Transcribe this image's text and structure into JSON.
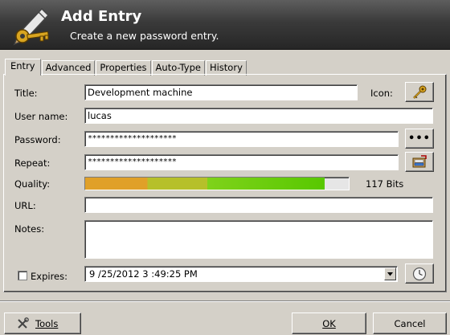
{
  "header": {
    "title": "Add Entry",
    "subtitle": "Create a new password entry."
  },
  "tabs": [
    "Entry",
    "Advanced",
    "Properties",
    "Auto-Type",
    "History"
  ],
  "form": {
    "title_label": "Title:",
    "title_value": "Development machine",
    "icon_label": "Icon:",
    "username_label": "User name:",
    "username_value": "lucas",
    "password_label": "Password:",
    "password_value": "********************",
    "repeat_label": "Repeat:",
    "repeat_value": "********************",
    "quality_label": "Quality:",
    "quality_fraction": 0.91,
    "quality_bits": "117 Bits",
    "url_label": "URL:",
    "url_value": "",
    "notes_label": "Notes:",
    "notes_value": "",
    "expires_label": "Expires:",
    "expires_checked": false,
    "expires_value": "9 /25/2012  3 :49:25 PM"
  },
  "buttons": {
    "reveal_label": "•••",
    "tools_label": "Tools",
    "ok_label": "OK",
    "cancel_label": "Cancel"
  }
}
